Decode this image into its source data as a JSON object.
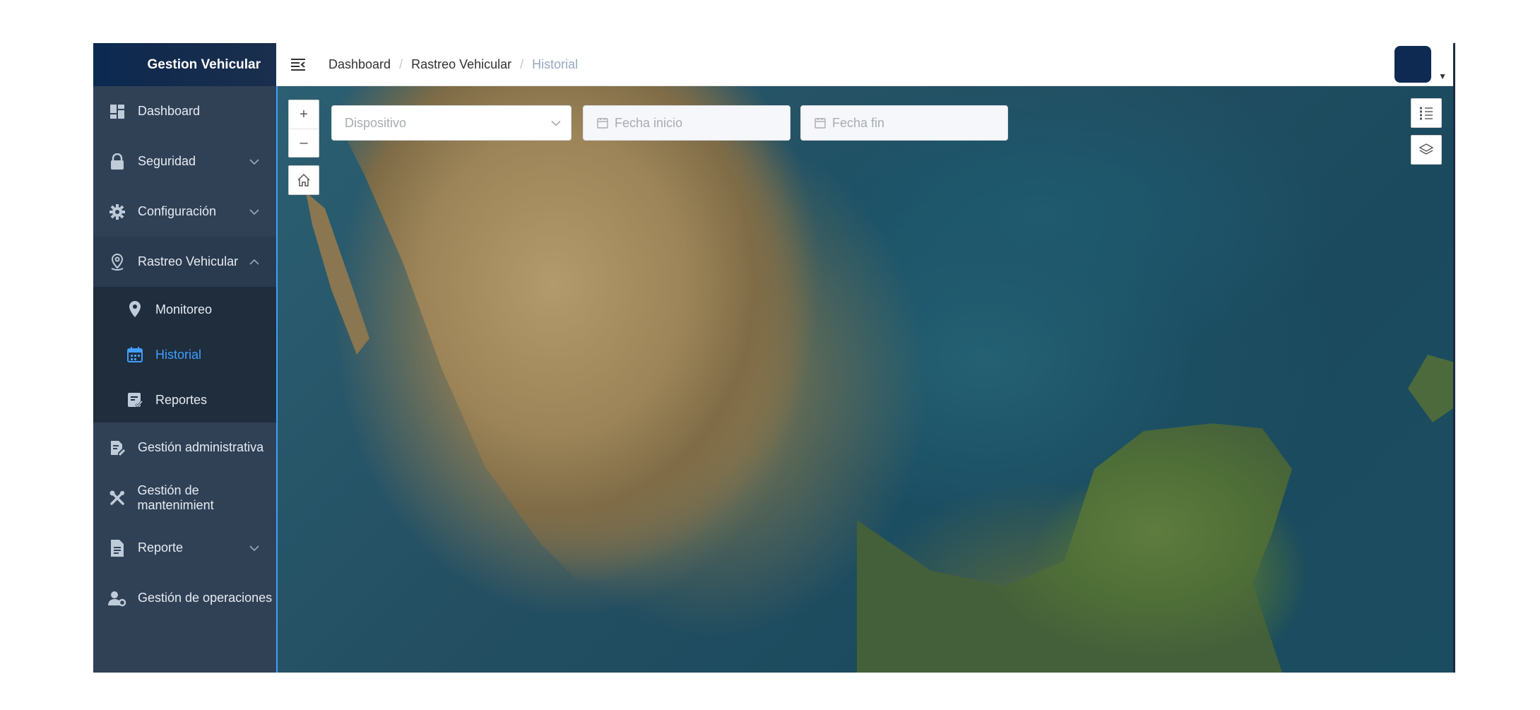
{
  "app": {
    "brand": "Gestion Vehicular"
  },
  "sidebar": {
    "items": [
      {
        "label": "Dashboard",
        "icon": "dashboard-icon"
      },
      {
        "label": "Seguridad",
        "icon": "lock-icon"
      },
      {
        "label": "Configuración",
        "icon": "gear-icon"
      },
      {
        "label": "Rastreo Vehicular",
        "icon": "map-pin-outline-icon"
      },
      {
        "label": "Gestión administrativa",
        "icon": "document-edit-icon"
      },
      {
        "label": "Gestión de mantenimient",
        "icon": "tools-icon"
      },
      {
        "label": "Reporte",
        "icon": "document-icon"
      },
      {
        "label": "Gestión de operaciones",
        "icon": "user-gear-icon"
      }
    ],
    "submenu": [
      {
        "label": "Monitoreo",
        "icon": "location-icon"
      },
      {
        "label": "Historial",
        "icon": "calendar-icon",
        "active": true
      },
      {
        "label": "Reportes",
        "icon": "report-icon"
      }
    ]
  },
  "header": {
    "breadcrumb": [
      "Dashboard",
      "Rastreo Vehicular",
      "Historial"
    ],
    "separator": "/"
  },
  "filters": {
    "device_placeholder": "Dispositivo",
    "start_placeholder": "Fecha inicio",
    "end_placeholder": "Fecha fin"
  },
  "map_controls": {
    "zoom_in": "+",
    "zoom_out": "–"
  },
  "colors": {
    "sidebar_bg": "#304156",
    "active": "#409eff",
    "brand_bg": "#112a4d"
  }
}
